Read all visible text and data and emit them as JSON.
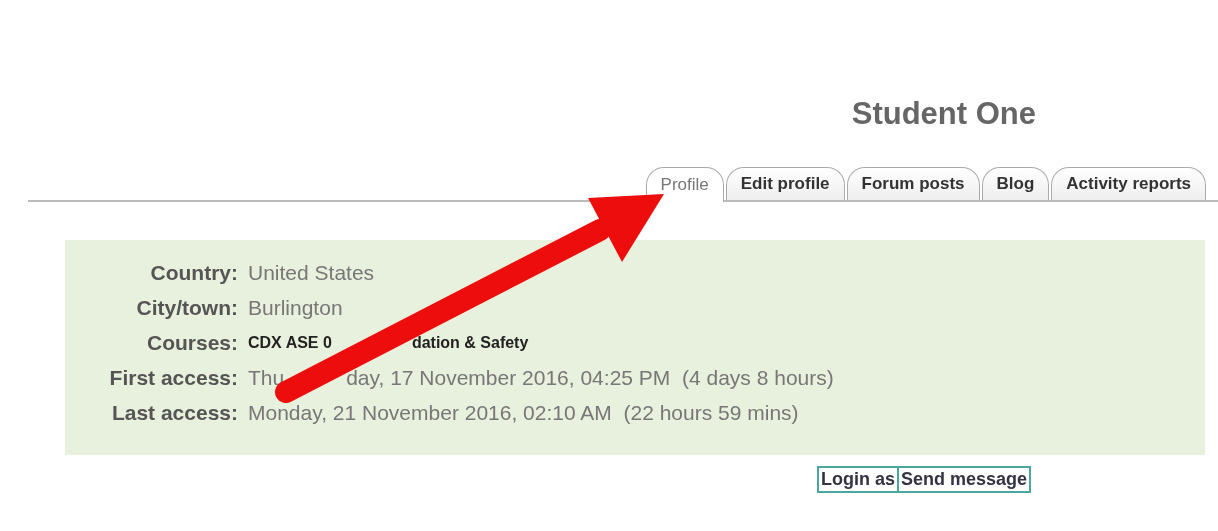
{
  "title": "Student One",
  "tabs": [
    {
      "label": "Profile",
      "selected": true
    },
    {
      "label": "Edit profile",
      "selected": false
    },
    {
      "label": "Forum posts",
      "selected": false
    },
    {
      "label": "Blog",
      "selected": false
    },
    {
      "label": "Activity reports",
      "selected": false
    }
  ],
  "details": [
    {
      "label": "Country:",
      "value_parts": [
        "United States"
      ],
      "kind": "plain"
    },
    {
      "label": "City/town:",
      "value_parts": [
        "Burlington"
      ],
      "kind": "plain"
    },
    {
      "label": "Courses:",
      "value_parts": [
        "CDX ASE 0",
        "dation & Safety"
      ],
      "kind": "link"
    },
    {
      "label": "First access:",
      "value_parts": [
        "Thu",
        "day, 17 November 2016, 04:25 PM  (4 days 8 hours)"
      ],
      "kind": "plain"
    },
    {
      "label": "Last access:",
      "value_parts": [
        "Monday, 21 November 2016, 02:10 AM  (22 hours 59 mins)"
      ],
      "kind": "plain"
    }
  ],
  "buttons": [
    "Login as",
    "Send message"
  ]
}
